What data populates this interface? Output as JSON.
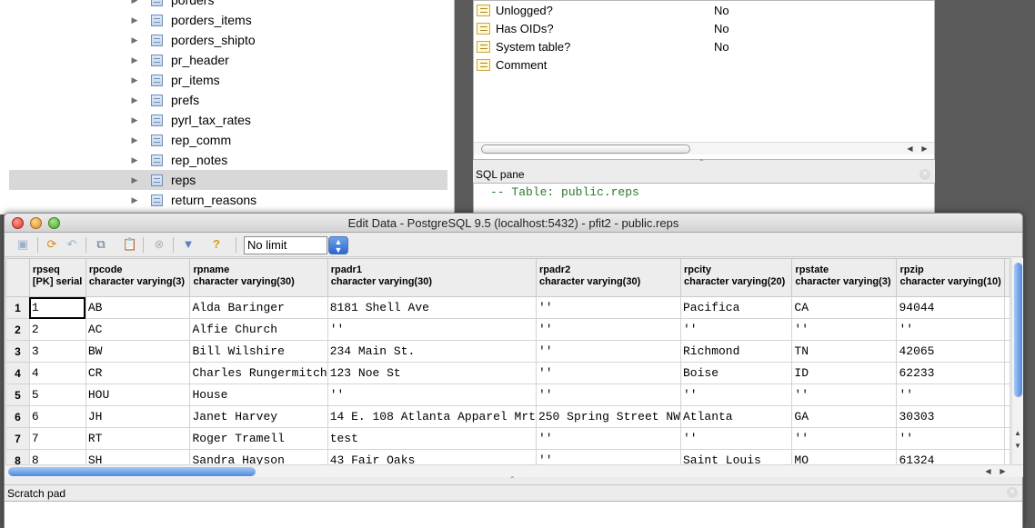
{
  "tree": {
    "items": [
      {
        "label": "porders",
        "selected": false
      },
      {
        "label": "porders_items",
        "selected": false
      },
      {
        "label": "porders_shipto",
        "selected": false
      },
      {
        "label": "pr_header",
        "selected": false
      },
      {
        "label": "pr_items",
        "selected": false
      },
      {
        "label": "prefs",
        "selected": false
      },
      {
        "label": "pyrl_tax_rates",
        "selected": false
      },
      {
        "label": "rep_comm",
        "selected": false
      },
      {
        "label": "rep_notes",
        "selected": false
      },
      {
        "label": "reps",
        "selected": true
      },
      {
        "label": "return_reasons",
        "selected": false
      }
    ]
  },
  "properties": {
    "rows": [
      {
        "name": "Unlogged?",
        "value": "No"
      },
      {
        "name": "Has OIDs?",
        "value": "No"
      },
      {
        "name": "System table?",
        "value": "No"
      },
      {
        "name": "Comment",
        "value": ""
      }
    ]
  },
  "sql_pane": {
    "title": "SQL pane",
    "text": "-- Table: public.reps"
  },
  "edit_window": {
    "title": "Edit Data - PostgreSQL 9.5 (localhost:5432) - pfit2 - public.reps",
    "limit_value": "No limit",
    "toolbar_icons": [
      "save-icon",
      "refresh-icon",
      "undo-icon",
      "copy-icon",
      "paste-icon",
      "delete-icon",
      "filter-icon",
      "help-icon"
    ]
  },
  "grid": {
    "columns": [
      {
        "name": "rpseq",
        "type": "[PK] serial"
      },
      {
        "name": "rpcode",
        "type": "character varying(3)"
      },
      {
        "name": "rpname",
        "type": "character varying(30)"
      },
      {
        "name": "rpadr1",
        "type": "character varying(30)"
      },
      {
        "name": "rpadr2",
        "type": "character varying(30)"
      },
      {
        "name": "rpcity",
        "type": "character varying(20)"
      },
      {
        "name": "rpstate",
        "type": "character varying(3)"
      },
      {
        "name": "rpzip",
        "type": "character varying(10)"
      }
    ],
    "rows": [
      {
        "num": "1",
        "cells": [
          "1",
          "AB",
          "Alda Baringer",
          "8181 Shell Ave",
          "''",
          "Pacifica",
          "CA",
          "94044"
        ]
      },
      {
        "num": "2",
        "cells": [
          "2",
          "AC",
          "Alfie Church",
          "''",
          "''",
          "''",
          "''",
          "''"
        ]
      },
      {
        "num": "3",
        "cells": [
          "3",
          "BW",
          "Bill Wilshire",
          "234 Main St.",
          "''",
          "Richmond",
          "TN",
          "42065"
        ]
      },
      {
        "num": "4",
        "cells": [
          "4",
          "CR",
          "Charles Rungermitch",
          "123 Noe St",
          "''",
          "Boise",
          "ID",
          "62233"
        ]
      },
      {
        "num": "5",
        "cells": [
          "5",
          "HOU",
          "House",
          "''",
          "''",
          "''",
          "''",
          "''"
        ]
      },
      {
        "num": "6",
        "cells": [
          "6",
          "JH",
          "Janet Harvey",
          "14 E. 108 Atlanta Apparel Mrt",
          "250 Spring Street NW",
          "Atlanta",
          "GA",
          "30303"
        ]
      },
      {
        "num": "7",
        "cells": [
          "7",
          "RT",
          "Roger Tramell",
          "test",
          "''",
          "''",
          "''",
          "''"
        ]
      },
      {
        "num": "8",
        "cells": [
          "8",
          "SH",
          "Sandra Hayson",
          "43 Fair Oaks",
          "''",
          "Saint Louis",
          "MO",
          "61324"
        ]
      }
    ]
  },
  "scratch_pad": {
    "title": "Scratch pad"
  }
}
